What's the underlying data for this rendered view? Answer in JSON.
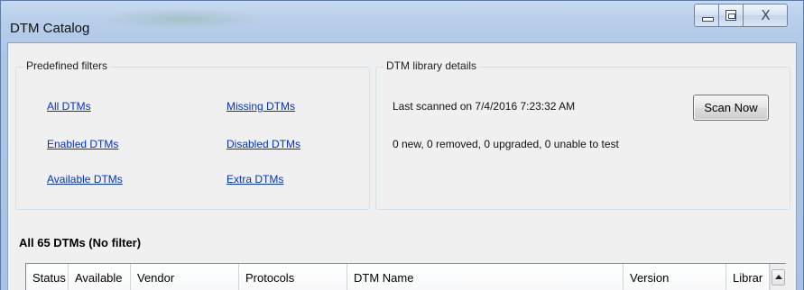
{
  "window": {
    "title": "DTM Catalog",
    "close_glyph": "X"
  },
  "filters": {
    "title": "Predefined filters",
    "links": {
      "all": "All DTMs",
      "enabled": "Enabled DTMs",
      "available": "Available DTMs",
      "missing": "Missing DTMs",
      "disabled": "Disabled DTMs",
      "extra": "Extra DTMs"
    }
  },
  "library": {
    "title": "DTM library details",
    "last_scanned": "Last scanned on 7/4/2016 7:23:32 AM",
    "summary": "0 new, 0 removed, 0 upgraded, 0 unable to test",
    "scan_button": "Scan Now"
  },
  "list": {
    "heading": "All 65 DTMs (No filter)",
    "columns": [
      "Status",
      "Available",
      "Vendor",
      "Protocols",
      "DTM Name",
      "Version",
      "Librar"
    ]
  },
  "icons": {
    "minimize": "minimize-icon",
    "maximize": "maximize-icon",
    "close": "close-icon",
    "scroll_up": "scroll-up-arrow-icon"
  },
  "colors": {
    "link": "#0033cc",
    "client_bg": "#f0f0f0",
    "titlebar": "#b9cfea"
  }
}
